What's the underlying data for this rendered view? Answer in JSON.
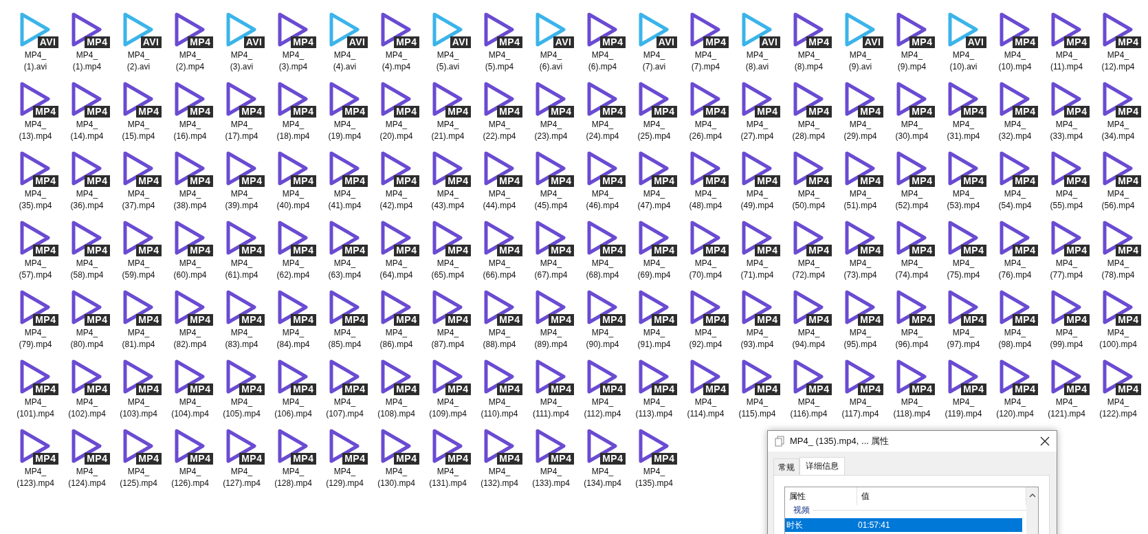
{
  "files": [
    {
      "kind": "avi",
      "badge": "AVI",
      "name": "MP4_ (1).avi"
    },
    {
      "kind": "mp4",
      "badge": "MP4",
      "name": "MP4_ (1).mp4"
    },
    {
      "kind": "avi",
      "badge": "AVI",
      "name": "MP4_ (2).avi"
    },
    {
      "kind": "mp4",
      "badge": "MP4",
      "name": "MP4_ (2).mp4"
    },
    {
      "kind": "avi",
      "badge": "AVI",
      "name": "MP4_ (3).avi"
    },
    {
      "kind": "mp4",
      "badge": "MP4",
      "name": "MP4_ (3).mp4"
    },
    {
      "kind": "avi",
      "badge": "AVI",
      "name": "MP4_ (4).avi"
    },
    {
      "kind": "mp4",
      "badge": "MP4",
      "name": "MP4_ (4).mp4"
    },
    {
      "kind": "avi",
      "badge": "AVI",
      "name": "MP4_ (5).avi"
    },
    {
      "kind": "mp4",
      "badge": "MP4",
      "name": "MP4_ (5).mp4"
    },
    {
      "kind": "avi",
      "badge": "AVI",
      "name": "MP4_ (6).avi"
    },
    {
      "kind": "mp4",
      "badge": "MP4",
      "name": "MP4_ (6).mp4"
    },
    {
      "kind": "avi",
      "badge": "AVI",
      "name": "MP4_ (7).avi"
    },
    {
      "kind": "mp4",
      "badge": "MP4",
      "name": "MP4_ (7).mp4"
    },
    {
      "kind": "avi",
      "badge": "AVI",
      "name": "MP4_ (8).avi"
    },
    {
      "kind": "mp4",
      "badge": "MP4",
      "name": "MP4_ (8).mp4"
    },
    {
      "kind": "avi",
      "badge": "AVI",
      "name": "MP4_ (9).avi"
    },
    {
      "kind": "mp4",
      "badge": "MP4",
      "name": "MP4_ (9).mp4"
    },
    {
      "kind": "avi",
      "badge": "AVI",
      "name": "MP4_ (10).avi"
    },
    {
      "kind": "mp4",
      "badge": "MP4",
      "name": "MP4_ (10).mp4"
    },
    {
      "kind": "mp4",
      "badge": "MP4",
      "name": "MP4_ (11).mp4"
    },
    {
      "kind": "mp4",
      "badge": "MP4",
      "name": "MP4_ (12).mp4"
    },
    {
      "kind": "mp4",
      "badge": "MP4",
      "name": "MP4_ (13).mp4"
    },
    {
      "kind": "mp4",
      "badge": "MP4",
      "name": "MP4_ (14).mp4"
    },
    {
      "kind": "mp4",
      "badge": "MP4",
      "name": "MP4_ (15).mp4"
    },
    {
      "kind": "mp4",
      "badge": "MP4",
      "name": "MP4_ (16).mp4"
    },
    {
      "kind": "mp4",
      "badge": "MP4",
      "name": "MP4_ (17).mp4"
    },
    {
      "kind": "mp4",
      "badge": "MP4",
      "name": "MP4_ (18).mp4"
    },
    {
      "kind": "mp4",
      "badge": "MP4",
      "name": "MP4_ (19).mp4"
    },
    {
      "kind": "mp4",
      "badge": "MP4",
      "name": "MP4_ (20).mp4"
    },
    {
      "kind": "mp4",
      "badge": "MP4",
      "name": "MP4_ (21).mp4"
    },
    {
      "kind": "mp4",
      "badge": "MP4",
      "name": "MP4_ (22).mp4"
    },
    {
      "kind": "mp4",
      "badge": "MP4",
      "name": "MP4_ (23).mp4"
    },
    {
      "kind": "mp4",
      "badge": "MP4",
      "name": "MP4_ (24).mp4"
    },
    {
      "kind": "mp4",
      "badge": "MP4",
      "name": "MP4_ (25).mp4"
    },
    {
      "kind": "mp4",
      "badge": "MP4",
      "name": "MP4_ (26).mp4"
    },
    {
      "kind": "mp4",
      "badge": "MP4",
      "name": "MP4_ (27).mp4"
    },
    {
      "kind": "mp4",
      "badge": "MP4",
      "name": "MP4_ (28).mp4"
    },
    {
      "kind": "mp4",
      "badge": "MP4",
      "name": "MP4_ (29).mp4"
    },
    {
      "kind": "mp4",
      "badge": "MP4",
      "name": "MP4_ (30).mp4"
    },
    {
      "kind": "mp4",
      "badge": "MP4",
      "name": "MP4_ (31).mp4"
    },
    {
      "kind": "mp4",
      "badge": "MP4",
      "name": "MP4_ (32).mp4"
    },
    {
      "kind": "mp4",
      "badge": "MP4",
      "name": "MP4_ (33).mp4"
    },
    {
      "kind": "mp4",
      "badge": "MP4",
      "name": "MP4_ (34).mp4"
    },
    {
      "kind": "mp4",
      "badge": "MP4",
      "name": "MP4_ (35).mp4"
    },
    {
      "kind": "mp4",
      "badge": "MP4",
      "name": "MP4_ (36).mp4"
    },
    {
      "kind": "mp4",
      "badge": "MP4",
      "name": "MP4_ (37).mp4"
    },
    {
      "kind": "mp4",
      "badge": "MP4",
      "name": "MP4_ (38).mp4"
    },
    {
      "kind": "mp4",
      "badge": "MP4",
      "name": "MP4_ (39).mp4"
    },
    {
      "kind": "mp4",
      "badge": "MP4",
      "name": "MP4_ (40).mp4"
    },
    {
      "kind": "mp4",
      "badge": "MP4",
      "name": "MP4_ (41).mp4"
    },
    {
      "kind": "mp4",
      "badge": "MP4",
      "name": "MP4_ (42).mp4"
    },
    {
      "kind": "mp4",
      "badge": "MP4",
      "name": "MP4_ (43).mp4"
    },
    {
      "kind": "mp4",
      "badge": "MP4",
      "name": "MP4_ (44).mp4"
    },
    {
      "kind": "mp4",
      "badge": "MP4",
      "name": "MP4_ (45).mp4"
    },
    {
      "kind": "mp4",
      "badge": "MP4",
      "name": "MP4_ (46).mp4"
    },
    {
      "kind": "mp4",
      "badge": "MP4",
      "name": "MP4_ (47).mp4"
    },
    {
      "kind": "mp4",
      "badge": "MP4",
      "name": "MP4_ (48).mp4"
    },
    {
      "kind": "mp4",
      "badge": "MP4",
      "name": "MP4_ (49).mp4"
    },
    {
      "kind": "mp4",
      "badge": "MP4",
      "name": "MP4_ (50).mp4"
    },
    {
      "kind": "mp4",
      "badge": "MP4",
      "name": "MP4_ (51).mp4"
    },
    {
      "kind": "mp4",
      "badge": "MP4",
      "name": "MP4_ (52).mp4"
    },
    {
      "kind": "mp4",
      "badge": "MP4",
      "name": "MP4_ (53).mp4"
    },
    {
      "kind": "mp4",
      "badge": "MP4",
      "name": "MP4_ (54).mp4"
    },
    {
      "kind": "mp4",
      "badge": "MP4",
      "name": "MP4_ (55).mp4"
    },
    {
      "kind": "mp4",
      "badge": "MP4",
      "name": "MP4_ (56).mp4"
    },
    {
      "kind": "mp4",
      "badge": "MP4",
      "name": "MP4_ (57).mp4"
    },
    {
      "kind": "mp4",
      "badge": "MP4",
      "name": "MP4_ (58).mp4"
    },
    {
      "kind": "mp4",
      "badge": "MP4",
      "name": "MP4_ (59).mp4"
    },
    {
      "kind": "mp4",
      "badge": "MP4",
      "name": "MP4_ (60).mp4"
    },
    {
      "kind": "mp4",
      "badge": "MP4",
      "name": "MP4_ (61).mp4"
    },
    {
      "kind": "mp4",
      "badge": "MP4",
      "name": "MP4_ (62).mp4"
    },
    {
      "kind": "mp4",
      "badge": "MP4",
      "name": "MP4_ (63).mp4"
    },
    {
      "kind": "mp4",
      "badge": "MP4",
      "name": "MP4_ (64).mp4"
    },
    {
      "kind": "mp4",
      "badge": "MP4",
      "name": "MP4_ (65).mp4"
    },
    {
      "kind": "mp4",
      "badge": "MP4",
      "name": "MP4_ (66).mp4"
    },
    {
      "kind": "mp4",
      "badge": "MP4",
      "name": "MP4_ (67).mp4"
    },
    {
      "kind": "mp4",
      "badge": "MP4",
      "name": "MP4_ (68).mp4"
    },
    {
      "kind": "mp4",
      "badge": "MP4",
      "name": "MP4_ (69).mp4"
    },
    {
      "kind": "mp4",
      "badge": "MP4",
      "name": "MP4_ (70).mp4"
    },
    {
      "kind": "mp4",
      "badge": "MP4",
      "name": "MP4_ (71).mp4"
    },
    {
      "kind": "mp4",
      "badge": "MP4",
      "name": "MP4_ (72).mp4"
    },
    {
      "kind": "mp4",
      "badge": "MP4",
      "name": "MP4_ (73).mp4"
    },
    {
      "kind": "mp4",
      "badge": "MP4",
      "name": "MP4_ (74).mp4"
    },
    {
      "kind": "mp4",
      "badge": "MP4",
      "name": "MP4_ (75).mp4"
    },
    {
      "kind": "mp4",
      "badge": "MP4",
      "name": "MP4_ (76).mp4"
    },
    {
      "kind": "mp4",
      "badge": "MP4",
      "name": "MP4_ (77).mp4"
    },
    {
      "kind": "mp4",
      "badge": "MP4",
      "name": "MP4_ (78).mp4"
    },
    {
      "kind": "mp4",
      "badge": "MP4",
      "name": "MP4_ (79).mp4"
    },
    {
      "kind": "mp4",
      "badge": "MP4",
      "name": "MP4_ (80).mp4"
    },
    {
      "kind": "mp4",
      "badge": "MP4",
      "name": "MP4_ (81).mp4"
    },
    {
      "kind": "mp4",
      "badge": "MP4",
      "name": "MP4_ (82).mp4"
    },
    {
      "kind": "mp4",
      "badge": "MP4",
      "name": "MP4_ (83).mp4"
    },
    {
      "kind": "mp4",
      "badge": "MP4",
      "name": "MP4_ (84).mp4"
    },
    {
      "kind": "mp4",
      "badge": "MP4",
      "name": "MP4_ (85).mp4"
    },
    {
      "kind": "mp4",
      "badge": "MP4",
      "name": "MP4_ (86).mp4"
    },
    {
      "kind": "mp4",
      "badge": "MP4",
      "name": "MP4_ (87).mp4"
    },
    {
      "kind": "mp4",
      "badge": "MP4",
      "name": "MP4_ (88).mp4"
    },
    {
      "kind": "mp4",
      "badge": "MP4",
      "name": "MP4_ (89).mp4"
    },
    {
      "kind": "mp4",
      "badge": "MP4",
      "name": "MP4_ (90).mp4"
    },
    {
      "kind": "mp4",
      "badge": "MP4",
      "name": "MP4_ (91).mp4"
    },
    {
      "kind": "mp4",
      "badge": "MP4",
      "name": "MP4_ (92).mp4"
    },
    {
      "kind": "mp4",
      "badge": "MP4",
      "name": "MP4_ (93).mp4"
    },
    {
      "kind": "mp4",
      "badge": "MP4",
      "name": "MP4_ (94).mp4"
    },
    {
      "kind": "mp4",
      "badge": "MP4",
      "name": "MP4_ (95).mp4"
    },
    {
      "kind": "mp4",
      "badge": "MP4",
      "name": "MP4_ (96).mp4"
    },
    {
      "kind": "mp4",
      "badge": "MP4",
      "name": "MP4_ (97).mp4"
    },
    {
      "kind": "mp4",
      "badge": "MP4",
      "name": "MP4_ (98).mp4"
    },
    {
      "kind": "mp4",
      "badge": "MP4",
      "name": "MP4_ (99).mp4"
    },
    {
      "kind": "mp4",
      "badge": "MP4",
      "name": "MP4_ (100).mp4"
    },
    {
      "kind": "mp4",
      "badge": "MP4",
      "name": "MP4_ (101).mp4"
    },
    {
      "kind": "mp4",
      "badge": "MP4",
      "name": "MP4_ (102).mp4"
    },
    {
      "kind": "mp4",
      "badge": "MP4",
      "name": "MP4_ (103).mp4"
    },
    {
      "kind": "mp4",
      "badge": "MP4",
      "name": "MP4_ (104).mp4"
    },
    {
      "kind": "mp4",
      "badge": "MP4",
      "name": "MP4_ (105).mp4"
    },
    {
      "kind": "mp4",
      "badge": "MP4",
      "name": "MP4_ (106).mp4"
    },
    {
      "kind": "mp4",
      "badge": "MP4",
      "name": "MP4_ (107).mp4"
    },
    {
      "kind": "mp4",
      "badge": "MP4",
      "name": "MP4_ (108).mp4"
    },
    {
      "kind": "mp4",
      "badge": "MP4",
      "name": "MP4_ (109).mp4"
    },
    {
      "kind": "mp4",
      "badge": "MP4",
      "name": "MP4_ (110).mp4"
    },
    {
      "kind": "mp4",
      "badge": "MP4",
      "name": "MP4_ (111).mp4"
    },
    {
      "kind": "mp4",
      "badge": "MP4",
      "name": "MP4_ (112).mp4"
    },
    {
      "kind": "mp4",
      "badge": "MP4",
      "name": "MP4_ (113).mp4"
    },
    {
      "kind": "mp4",
      "badge": "MP4",
      "name": "MP4_ (114).mp4"
    },
    {
      "kind": "mp4",
      "badge": "MP4",
      "name": "MP4_ (115).mp4"
    },
    {
      "kind": "mp4",
      "badge": "MP4",
      "name": "MP4_ (116).mp4"
    },
    {
      "kind": "mp4",
      "badge": "MP4",
      "name": "MP4_ (117).mp4"
    },
    {
      "kind": "mp4",
      "badge": "MP4",
      "name": "MP4_ (118).mp4"
    },
    {
      "kind": "mp4",
      "badge": "MP4",
      "name": "MP4_ (119).mp4"
    },
    {
      "kind": "mp4",
      "badge": "MP4",
      "name": "MP4_ (120).mp4"
    },
    {
      "kind": "mp4",
      "badge": "MP4",
      "name": "MP4_ (121).mp4"
    },
    {
      "kind": "mp4",
      "badge": "MP4",
      "name": "MP4_ (122).mp4"
    },
    {
      "kind": "mp4",
      "badge": "MP4",
      "name": "MP4_ (123).mp4"
    },
    {
      "kind": "mp4",
      "badge": "MP4",
      "name": "MP4_ (124).mp4"
    },
    {
      "kind": "mp4",
      "badge": "MP4",
      "name": "MP4_ (125).mp4"
    },
    {
      "kind": "mp4",
      "badge": "MP4",
      "name": "MP4_ (126).mp4"
    },
    {
      "kind": "mp4",
      "badge": "MP4",
      "name": "MP4_ (127).mp4"
    },
    {
      "kind": "mp4",
      "badge": "MP4",
      "name": "MP4_ (128).mp4"
    },
    {
      "kind": "mp4",
      "badge": "MP4",
      "name": "MP4_ (129).mp4"
    },
    {
      "kind": "mp4",
      "badge": "MP4",
      "name": "MP4_ (130).mp4"
    },
    {
      "kind": "mp4",
      "badge": "MP4",
      "name": "MP4_ (131).mp4"
    },
    {
      "kind": "mp4",
      "badge": "MP4",
      "name": "MP4_ (132).mp4"
    },
    {
      "kind": "mp4",
      "badge": "MP4",
      "name": "MP4_ (133).mp4"
    },
    {
      "kind": "mp4",
      "badge": "MP4",
      "name": "MP4_ (134).mp4"
    },
    {
      "kind": "mp4",
      "badge": "MP4",
      "name": "MP4_ (135).mp4"
    }
  ],
  "dialog": {
    "title": "MP4_ (135).mp4, ... 属性",
    "tabs": [
      {
        "label": "常规",
        "selected": false
      },
      {
        "label": "详细信息",
        "selected": true
      }
    ],
    "columns": [
      "属性",
      "值"
    ],
    "group": "视频",
    "rows": [
      {
        "property": "时长",
        "value": "01:57:41",
        "selected": true
      }
    ]
  }
}
